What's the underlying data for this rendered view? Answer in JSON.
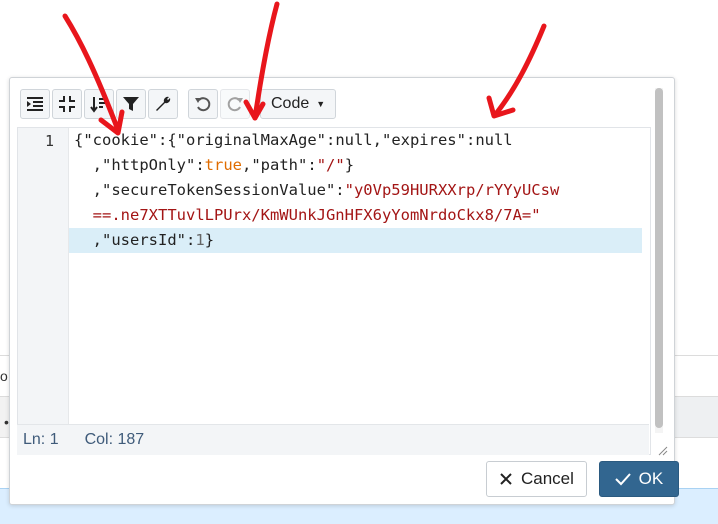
{
  "toolbar": {
    "buttons": [
      "indent-icon",
      "collapse-icon",
      "sort-icon",
      "filter-icon",
      "wrench-icon",
      "undo-icon",
      "redo-icon"
    ],
    "mode_label": "Code"
  },
  "editor": {
    "line_number": "1",
    "lines": [
      [
        {
          "t": "{",
          "c": "key"
        },
        {
          "t": "\"cookie\"",
          "c": "key"
        },
        {
          "t": ":{",
          "c": "key"
        },
        {
          "t": "\"originalMaxAge\"",
          "c": "key"
        },
        {
          "t": ":null,",
          "c": "key"
        },
        {
          "t": "\"expires\"",
          "c": "key"
        },
        {
          "t": ":null",
          "c": "key"
        }
      ],
      [
        {
          "t": "  ,",
          "c": "key"
        },
        {
          "t": "\"httpOnly\"",
          "c": "key"
        },
        {
          "t": ":",
          "c": "key"
        },
        {
          "t": "true",
          "c": "bool"
        },
        {
          "t": ",",
          "c": "key"
        },
        {
          "t": "\"path\"",
          "c": "key"
        },
        {
          "t": ":",
          "c": "key"
        },
        {
          "t": "\"/\"",
          "c": "str"
        },
        {
          "t": "}",
          "c": "key"
        }
      ],
      [
        {
          "t": "  ,",
          "c": "key"
        },
        {
          "t": "\"secureTokenSessionValue\"",
          "c": "key"
        },
        {
          "t": ":",
          "c": "key"
        },
        {
          "t": "\"y0Vp59HURXXrp/rYYyUCsw",
          "c": "str"
        }
      ],
      [
        {
          "t": "  ==.ne7XTTuvlLPUrx/KmWUnkJGnHFX6yYomNrdoCkx8/7A=\"",
          "c": "str"
        }
      ],
      [
        {
          "t": "  ,",
          "c": "key"
        },
        {
          "t": "\"usersId\"",
          "c": "key"
        },
        {
          "t": ":",
          "c": "key"
        },
        {
          "t": "1",
          "c": "num"
        },
        {
          "t": "}",
          "c": "key"
        }
      ]
    ]
  },
  "status": {
    "ln": "Ln: 1",
    "col": "Col: 187"
  },
  "buttons": {
    "cancel": "Cancel",
    "ok": "OK"
  },
  "colors": {
    "ok_button": "#326690",
    "active_line": "#daeef8",
    "annotation_arrow": "#e8161c"
  }
}
